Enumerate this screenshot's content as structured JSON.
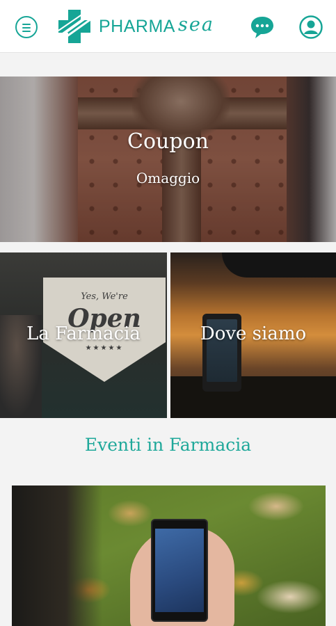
{
  "header": {
    "brand_pharma": "PHARMA",
    "brand_sea": "sea",
    "menu_icon": "menu-icon",
    "chat_icon": "chat-bubble-icon",
    "user_icon": "user-icon",
    "accent_color": "#16a596"
  },
  "tiles": {
    "coupon": {
      "title": "Coupon",
      "subtitle": "Omaggio"
    },
    "farmacia": {
      "title": "La Farmacia",
      "sign_line1": "Yes, We're",
      "sign_line2": "Open",
      "sign_stars": "★★★★★"
    },
    "dove": {
      "title": "Dove siamo"
    }
  },
  "events": {
    "title": "Eventi in Farmacia"
  }
}
